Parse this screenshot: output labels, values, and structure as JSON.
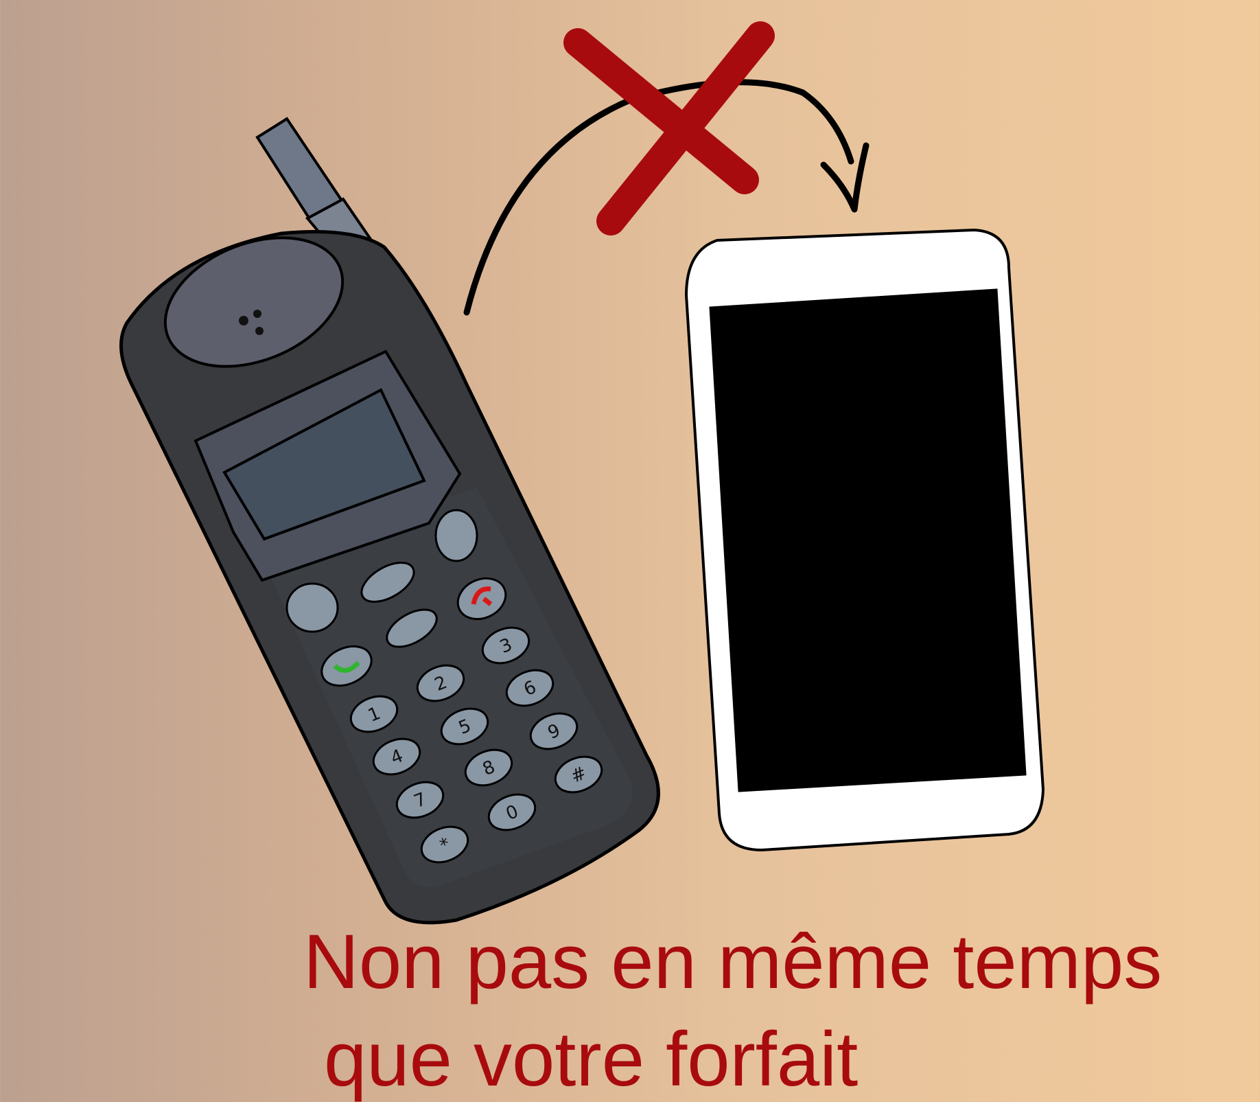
{
  "caption": {
    "line1": "Non pas en même temps",
    "line2": "que votre forfait",
    "color": "#a80b0e"
  },
  "illustration": {
    "old_phone": {
      "keypad_keys": [
        "1",
        "2",
        "3",
        "4",
        "5",
        "6",
        "7",
        "8",
        "9",
        "*",
        "0",
        "#"
      ],
      "body_color": "#383a3e",
      "call_key_color": "#2fb52f",
      "end_key_color": "#d81818"
    },
    "smartphone": {
      "frame_color": "#ffffff",
      "screen_color": "#000000"
    },
    "cross_color": "#a80b0e",
    "arrow_color": "#000000"
  }
}
